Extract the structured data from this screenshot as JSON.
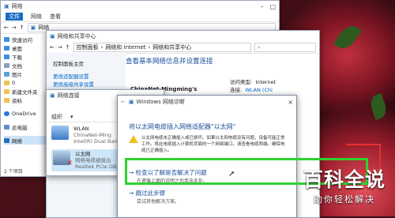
{
  "explorer": {
    "title": "网络",
    "tabs": [
      "文件",
      "网络",
      "查看"
    ],
    "address": "网络",
    "nav_items": [
      {
        "label": "快速访问",
        "icon": "star-icon"
      },
      {
        "label": "桌面",
        "icon": "desktop-icon"
      },
      {
        "label": "下载",
        "icon": "download-icon"
      },
      {
        "label": "文档",
        "icon": "document-icon"
      },
      {
        "label": "图片",
        "icon": "picture-icon"
      },
      {
        "label": "0",
        "icon": "folder-icon"
      },
      {
        "label": "新建文件夹",
        "icon": "folder-icon"
      },
      {
        "label": "资料",
        "icon": "folder-icon"
      },
      {
        "label": "OneDrive",
        "icon": "cloud-icon"
      },
      {
        "label": "此电脑",
        "icon": "computer-icon"
      },
      {
        "label": "网络",
        "icon": "network-icon"
      }
    ],
    "status": "2 个项目"
  },
  "control_panel": {
    "title": "网络和共享中心",
    "breadcrumb": [
      "控制面板",
      "网络和 Internet",
      "网络和共享中心"
    ],
    "left_links": [
      "控制面板主页",
      "更改适配器设置",
      "更改高级共享设置"
    ],
    "heading": "查看基本网络信息并设置连接",
    "network_name": "ChinaNet-Mingming's",
    "access_type_label": "访问类型:",
    "access_type_value": "Internet",
    "connection_label": "连接:",
    "connection_value": "WLAN (Chi"
  },
  "net_connections": {
    "title": "网络连接",
    "organize": "组织",
    "adapters": [
      {
        "name": "WLAN",
        "line1": "ChinaNet-Ming",
        "line2": "Intel(R) Dual Ban"
      },
      {
        "name": "以太网",
        "line1": "网络电缆被拔出",
        "line2": "Realtek PCIe GB"
      }
    ]
  },
  "diagnostics": {
    "title": "Windows 网络诊断",
    "heading": "将以太网电缆插入网络适配器\"以太网\"",
    "warning": "以太网电缆未正确插入或已损坏。如果以太网电缆没有问题，设备可能正常工作。将此电缆插入计算机背面的一个网络端口。请查看电缆两端，确保电缆已正确插入。",
    "option1_title": "检查以了解是否解决了问题",
    "option1_sub": "在遵循上面的说明之后单击此处。",
    "option2_title": "跳过此步骤",
    "option2_sub": "尝试其他解决方案。",
    "close": "×"
  },
  "watermark": {
    "title": "百科全说",
    "subtitle": "助你轻松解决"
  },
  "colors": {
    "highlight_box": "#2fd12f",
    "link": "#0066cc",
    "warning": "#f0c020"
  }
}
